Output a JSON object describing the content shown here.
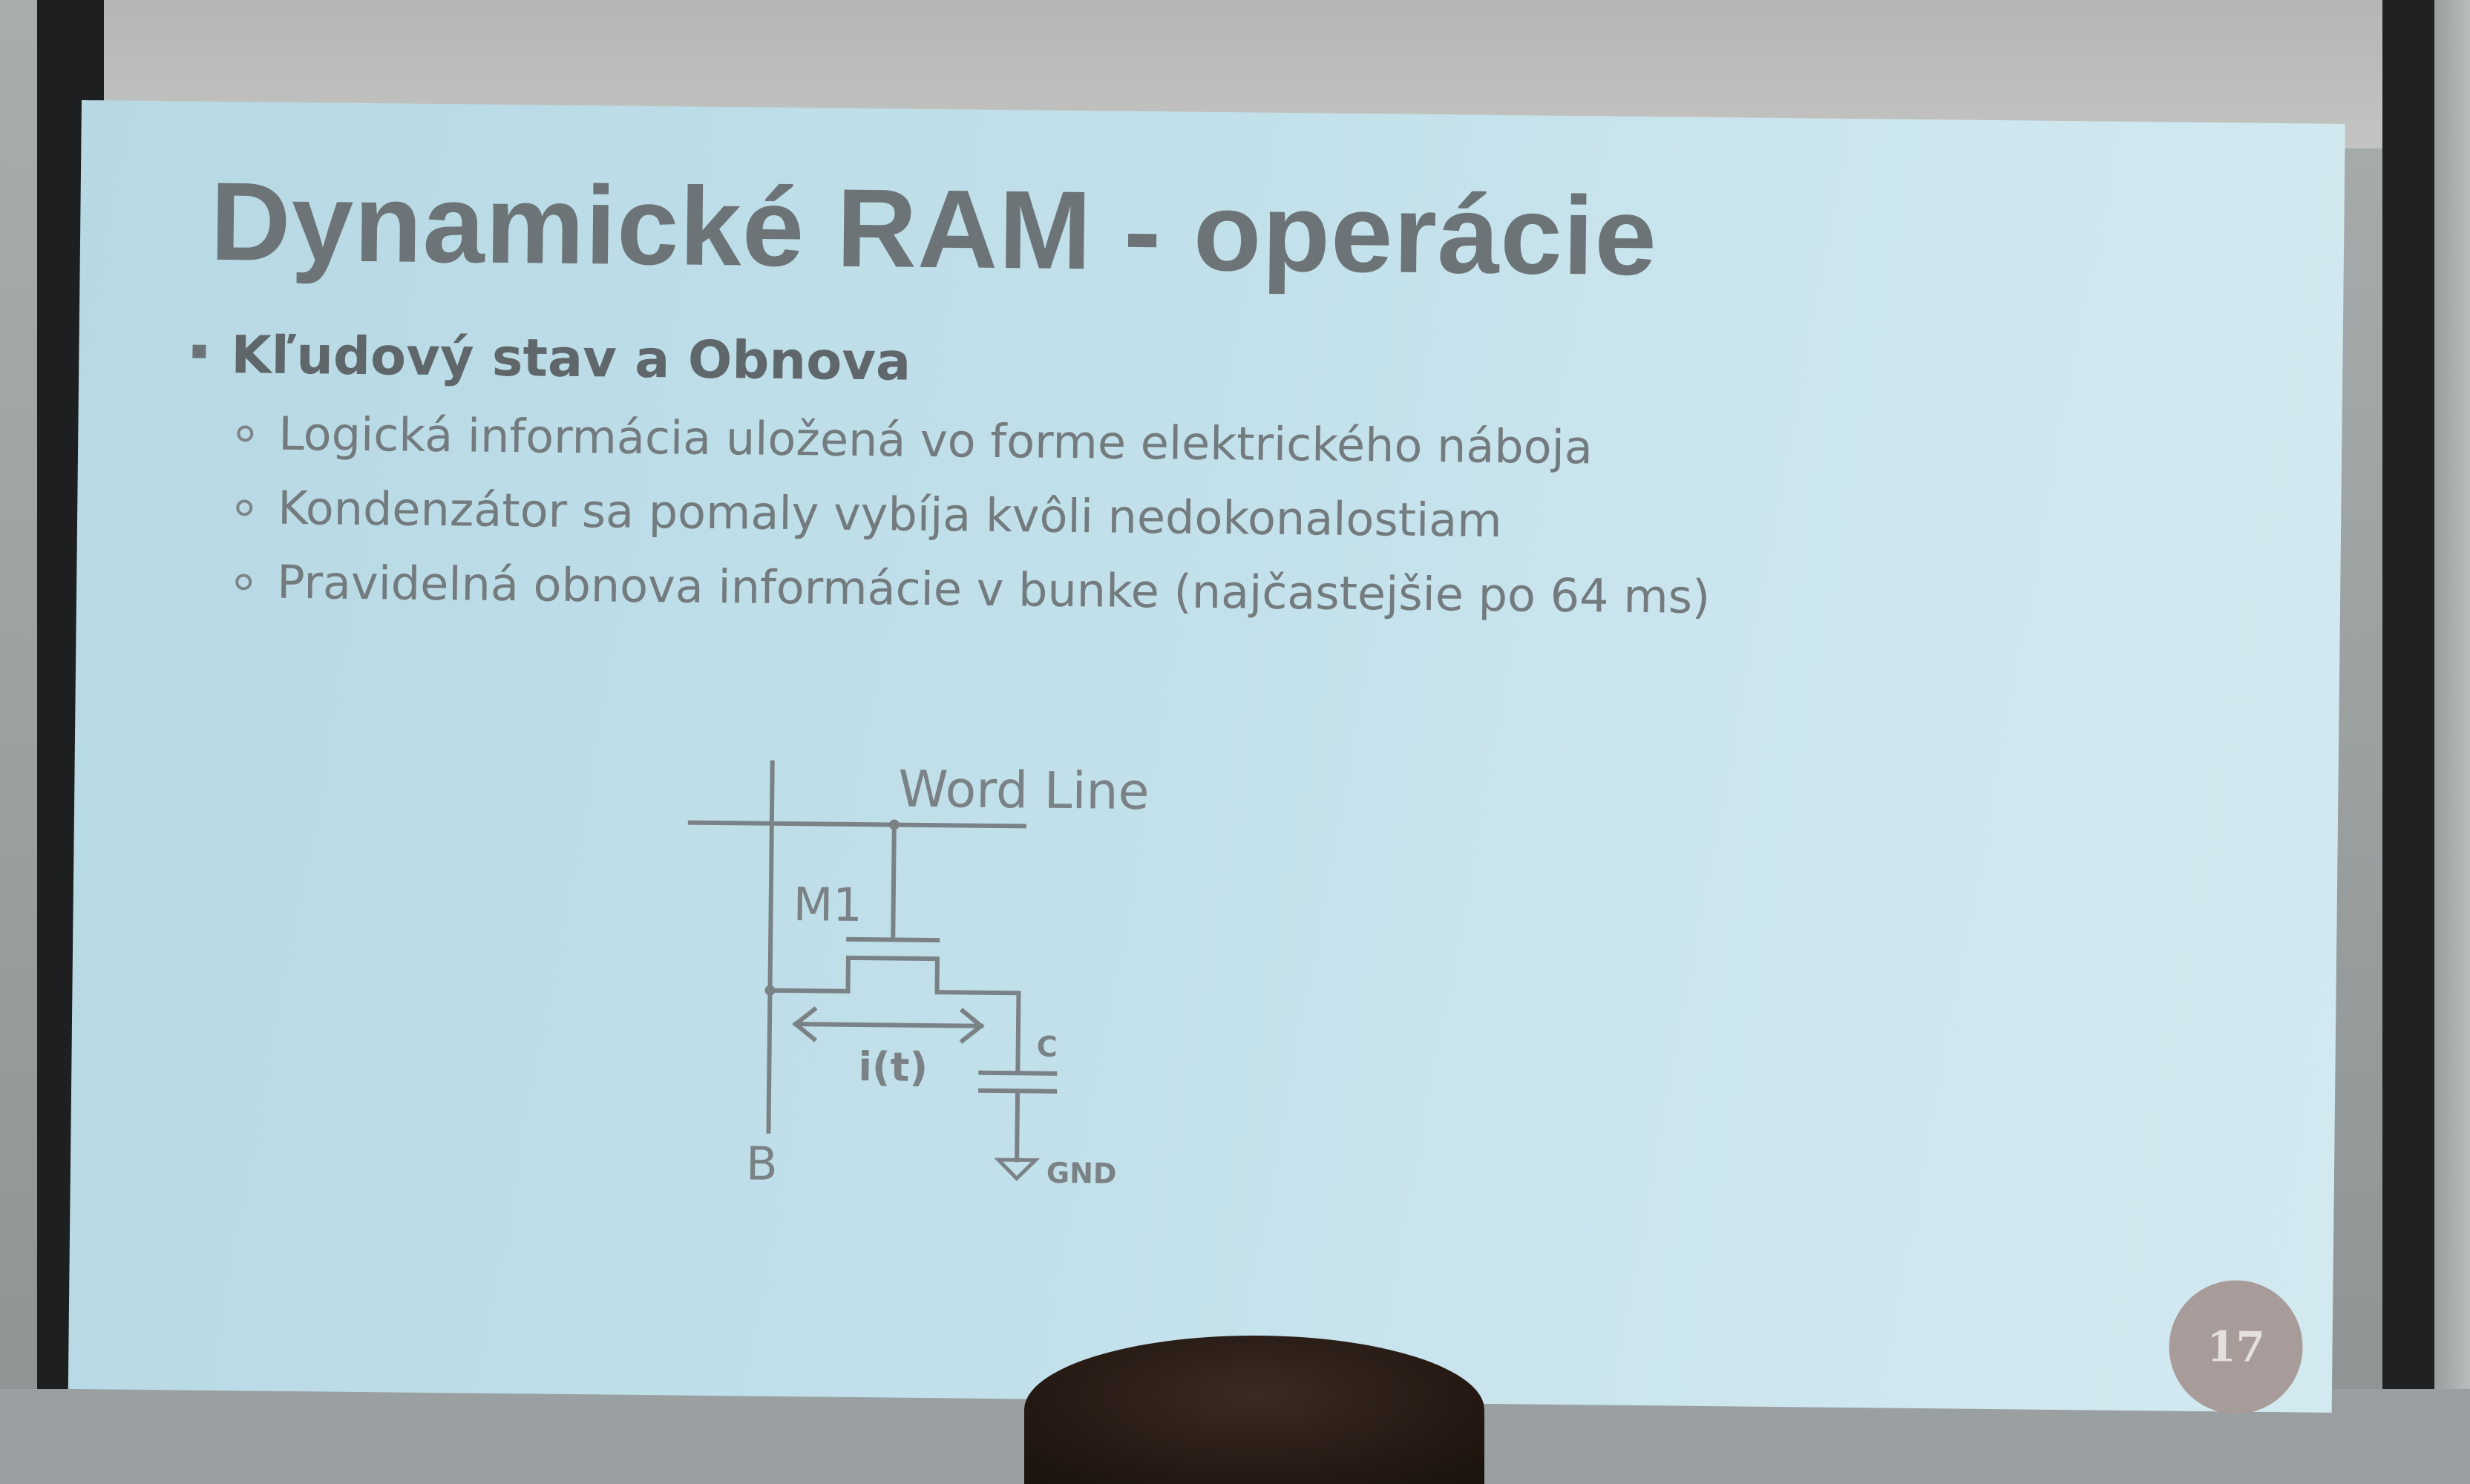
{
  "slide": {
    "title": "Dynamické RAM - operácie",
    "bullet": "Kľudový stav a Obnova",
    "sub_items": [
      "Logická informácia uložená vo forme elektrického náboja",
      "Kondenzátor sa pomaly vybíja kvôli nedokonalostiam",
      "Pravidelná obnova informácie v bunke (najčastejšie po 64 ms)"
    ],
    "page_number": "17"
  },
  "circuit": {
    "word_line_label": "Word Line",
    "transistor_label": "M1",
    "current_label": "i(t)",
    "capacitor_label": "C",
    "bitline_label": "B",
    "ground_label": "GND"
  },
  "colors": {
    "slide_background": "#c1e0ea",
    "title_text": "#6d7477",
    "body_text": "#737b7e",
    "page_badge": "#a89c9a",
    "screen_frame": "#1e1f21"
  }
}
